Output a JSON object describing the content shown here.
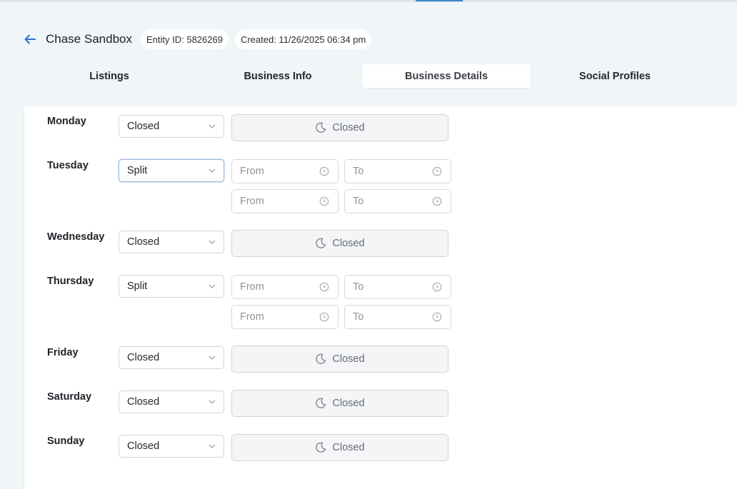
{
  "header": {
    "title": "Chase Sandbox",
    "entity_id": "Entity ID: 5826269",
    "created": "Created: 11/26/2025 06:34 pm"
  },
  "tabs": [
    {
      "label": "Listings"
    },
    {
      "label": "Business Info"
    },
    {
      "label": "Business Details",
      "active": true
    },
    {
      "label": "Social Profiles"
    }
  ],
  "hours": {
    "from_placeholder": "From",
    "to_placeholder": "To",
    "closed_label": "Closed",
    "days": [
      {
        "name": "Monday",
        "mode": "Closed"
      },
      {
        "name": "Tuesday",
        "mode": "Split"
      },
      {
        "name": "Wednesday",
        "mode": "Closed"
      },
      {
        "name": "Thursday",
        "mode": "Split"
      },
      {
        "name": "Friday",
        "mode": "Closed"
      },
      {
        "name": "Saturday",
        "mode": "Closed"
      },
      {
        "name": "Sunday",
        "mode": "Closed"
      }
    ]
  },
  "colors": {
    "accent": "#3a86c8",
    "back_arrow": "#2f6fd6",
    "page_bg": "#f0f5f8"
  },
  "icons": {
    "back": "arrow-left-icon",
    "select": "chevron-down-icon",
    "time": "clock-icon",
    "closed": "moon-icon"
  }
}
